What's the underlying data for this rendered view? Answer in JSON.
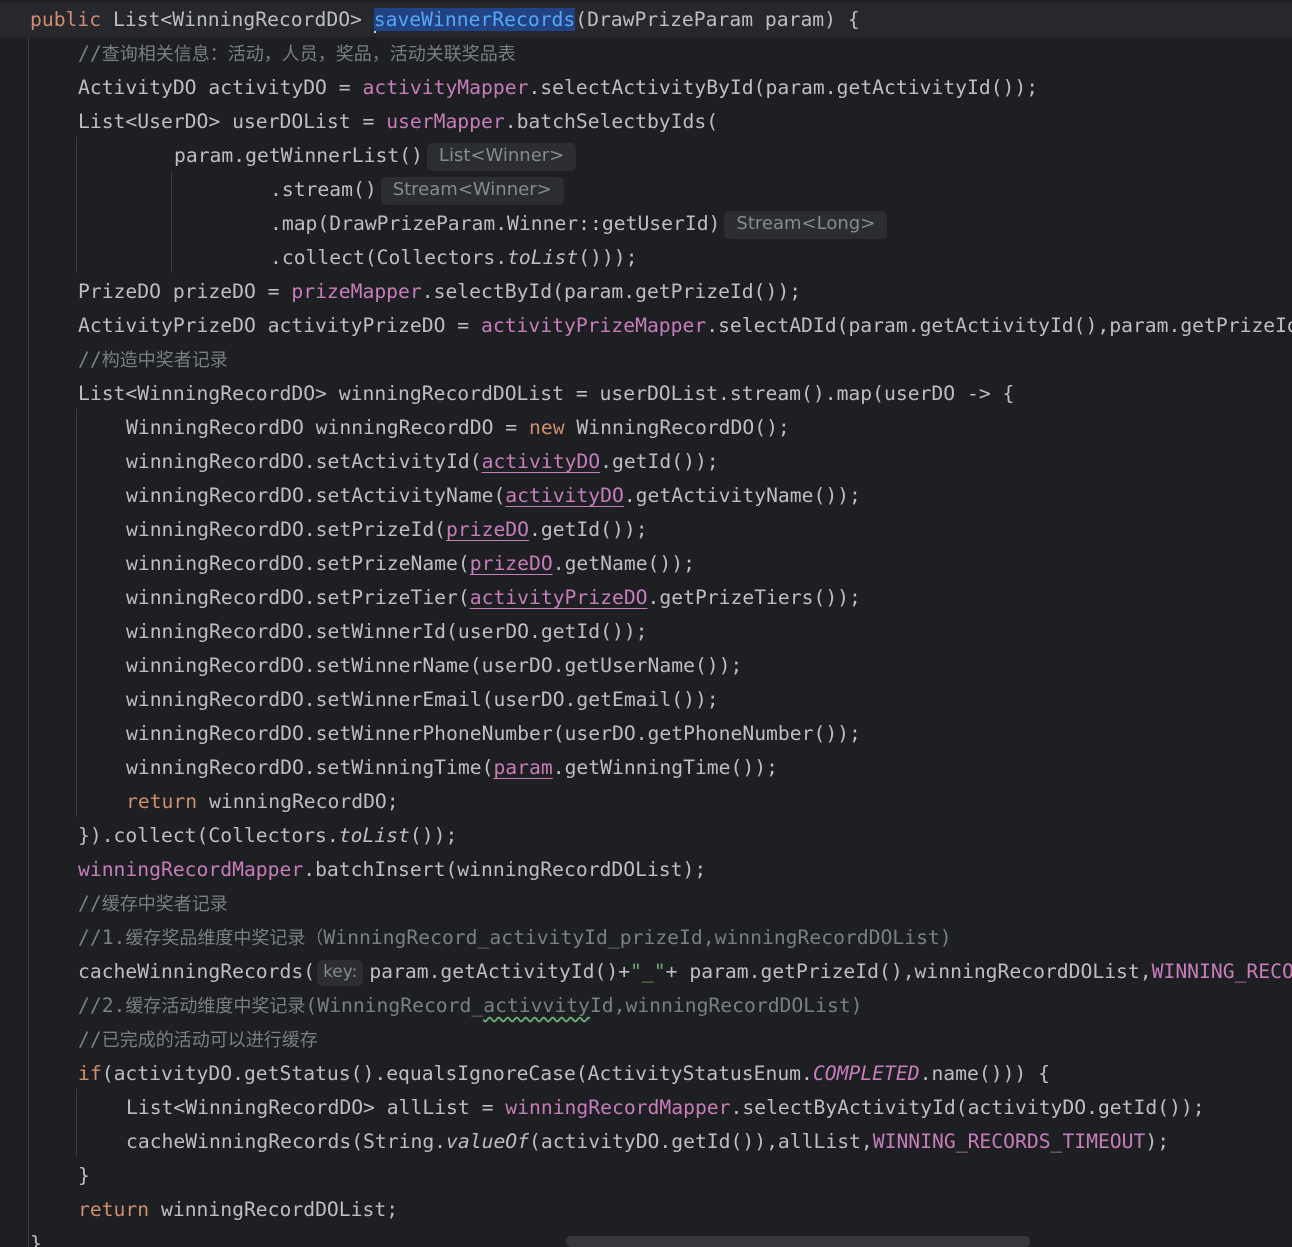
{
  "editor": {
    "method_name": "saveWinnerRecords",
    "lines": [
      {
        "tokens": [
          [
            "kw",
            "public "
          ],
          [
            "",
            "List<WinningRecordDO> "
          ],
          [
            "caret",
            ""
          ],
          [
            "fn sel",
            "saveWinnerRecords"
          ],
          [
            "",
            "(DrawPrizeParam param) {"
          ]
        ]
      },
      {
        "tokens": [
          [
            "cm",
            "//"
          ],
          [
            "cm cmt-cjk",
            "查询相关信息：活动，人员，奖品，活动关联奖品表"
          ]
        ]
      },
      {
        "tokens": [
          [
            "",
            "ActivityDO activityDO = "
          ],
          [
            "fld",
            "activityMapper"
          ],
          [
            "",
            ".selectActivityById(param.getActivityId());"
          ]
        ]
      },
      {
        "tokens": [
          [
            "",
            "List<UserDO> userDOList = "
          ],
          [
            "fld",
            "userMapper"
          ],
          [
            "",
            ".batchSelectbyIds("
          ]
        ]
      },
      {
        "tokens": [
          [
            "",
            "param.getWinnerList()"
          ],
          [
            "hint",
            "List<Winner>"
          ]
        ]
      },
      {
        "tokens": [
          [
            "",
            ".stream()"
          ],
          [
            "hint",
            "Stream<Winner>"
          ]
        ]
      },
      {
        "tokens": [
          [
            "",
            ".map(DrawPrizeParam.Winner::getUserId)"
          ],
          [
            "hint",
            "Stream<Long>"
          ]
        ]
      },
      {
        "tokens": [
          [
            "",
            ".collect(Collectors."
          ],
          [
            "it",
            "toList"
          ],
          [
            "",
            "()));"
          ]
        ]
      },
      {
        "tokens": [
          [
            "",
            "PrizeDO prizeDO = "
          ],
          [
            "fld",
            "prizeMapper"
          ],
          [
            "",
            ".selectById(param.getPrizeId());"
          ]
        ]
      },
      {
        "tokens": [
          [
            "",
            "ActivityPrizeDO activityPrizeDO = "
          ],
          [
            "fld",
            "activityPrizeMapper"
          ],
          [
            "",
            ".selectADId(param.getActivityId(),param.getPrizeId());"
          ]
        ]
      },
      {
        "tokens": [
          [
            "cm",
            "//"
          ],
          [
            "cm cmt-cjk",
            "构造中奖者记录"
          ]
        ]
      },
      {
        "tokens": [
          [
            "",
            "List<WinningRecordDO> winningRecordDOList = userDOList.stream().map(userDO -> {"
          ]
        ]
      },
      {
        "tokens": [
          [
            "",
            "WinningRecordDO winningRecordDO = "
          ],
          [
            "kw",
            "new "
          ],
          [
            "",
            "WinningRecordDO();"
          ]
        ]
      },
      {
        "tokens": [
          [
            "",
            "winningRecordDO.setActivityId("
          ],
          [
            "ul-fld",
            "activityDO"
          ],
          [
            "",
            ".getId());"
          ]
        ]
      },
      {
        "tokens": [
          [
            "",
            "winningRecordDO.setActivityName("
          ],
          [
            "ul-fld",
            "activityDO"
          ],
          [
            "",
            ".getActivityName());"
          ]
        ]
      },
      {
        "tokens": [
          [
            "",
            "winningRecordDO.setPrizeId("
          ],
          [
            "ul-fld",
            "prizeDO"
          ],
          [
            "",
            ".getId());"
          ]
        ]
      },
      {
        "tokens": [
          [
            "",
            "winningRecordDO.setPrizeName("
          ],
          [
            "ul-fld",
            "prizeDO"
          ],
          [
            "",
            ".getName());"
          ]
        ]
      },
      {
        "tokens": [
          [
            "",
            "winningRecordDO.setPrizeTier("
          ],
          [
            "ul-fld",
            "activityPrizeDO"
          ],
          [
            "",
            ".getPrizeTiers());"
          ]
        ]
      },
      {
        "tokens": [
          [
            "",
            "winningRecordDO.setWinnerId(userDO.getId());"
          ]
        ]
      },
      {
        "tokens": [
          [
            "",
            "winningRecordDO.setWinnerName(userDO.getUserName());"
          ]
        ]
      },
      {
        "tokens": [
          [
            "",
            "winningRecordDO.setWinnerEmail(userDO.getEmail());"
          ]
        ]
      },
      {
        "tokens": [
          [
            "",
            "winningRecordDO.setWinnerPhoneNumber(userDO.getPhoneNumber());"
          ]
        ]
      },
      {
        "tokens": [
          [
            "",
            "winningRecordDO.setWinningTime("
          ],
          [
            "ul-fld",
            "param"
          ],
          [
            "",
            ".getWinningTime());"
          ]
        ]
      },
      {
        "tokens": [
          [
            "kw",
            "return "
          ],
          [
            "",
            "winningRecordDO;"
          ]
        ]
      },
      {
        "tokens": [
          [
            "",
            "}).collect(Collectors."
          ],
          [
            "it",
            "toList"
          ],
          [
            "",
            "());"
          ]
        ]
      },
      {
        "tokens": [
          [
            "fld",
            "winningRecordMapper"
          ],
          [
            "",
            ".batchInsert(winningRecordDOList);"
          ]
        ]
      },
      {
        "tokens": [
          [
            "cm",
            "//"
          ],
          [
            "cm cmt-cjk",
            "缓存中奖者记录"
          ]
        ]
      },
      {
        "tokens": [
          [
            "cm",
            "//1."
          ],
          [
            "cm cmt-cjk",
            "缓存奖品维度中奖记录（"
          ],
          [
            "cm",
            "WinningRecord_activityId_prizeId,winningRecordDOList)"
          ]
        ]
      },
      {
        "tokens": [
          [
            "",
            "cacheWinningRecords("
          ],
          [
            "phint",
            "key:"
          ],
          [
            "",
            "param.getActivityId()+"
          ],
          [
            "str",
            "\"_\""
          ],
          [
            "",
            "+ param.getPrizeId(),winningRecordDOList,"
          ],
          [
            "fld",
            "WINNING_RECORDS_TIMEOUT"
          ],
          [
            "",
            ");"
          ]
        ]
      },
      {
        "tokens": [
          [
            "cm",
            "//2."
          ],
          [
            "cm cmt-cjk",
            "缓存活动维度中奖记录"
          ],
          [
            "cm",
            "(WinningRecord_"
          ],
          [
            "cm wavy",
            "activvity"
          ],
          [
            "cm",
            "Id,winningRecordDOList)"
          ]
        ]
      },
      {
        "tokens": [
          [
            "cm",
            "//"
          ],
          [
            "cm cmt-cjk",
            "已完成的活动可以进行缓存"
          ]
        ]
      },
      {
        "tokens": [
          [
            "kw",
            "if"
          ],
          [
            "",
            "(activityDO.getStatus().equalsIgnoreCase(ActivityStatusEnum."
          ],
          [
            "itf",
            "COMPLETED"
          ],
          [
            "",
            ".name())) {"
          ]
        ]
      },
      {
        "tokens": [
          [
            "",
            "List<WinningRecordDO> allList = "
          ],
          [
            "fld",
            "winningRecordMapper"
          ],
          [
            "",
            ".selectByActivityId(activityDO.getId());"
          ]
        ]
      },
      {
        "tokens": [
          [
            "",
            "cacheWinningRecords(String."
          ],
          [
            "it",
            "valueOf"
          ],
          [
            "",
            "(activityDO.getId()),allList,"
          ],
          [
            "fld",
            "WINNING_RECORDS_TIMEOUT"
          ],
          [
            "",
            ");"
          ]
        ]
      },
      {
        "tokens": [
          [
            "",
            "}"
          ]
        ]
      },
      {
        "tokens": [
          [
            "kw",
            "return "
          ],
          [
            "",
            "winningRecordDOList;"
          ]
        ]
      },
      {
        "tokens": [
          [
            "",
            "}"
          ]
        ]
      }
    ]
  }
}
